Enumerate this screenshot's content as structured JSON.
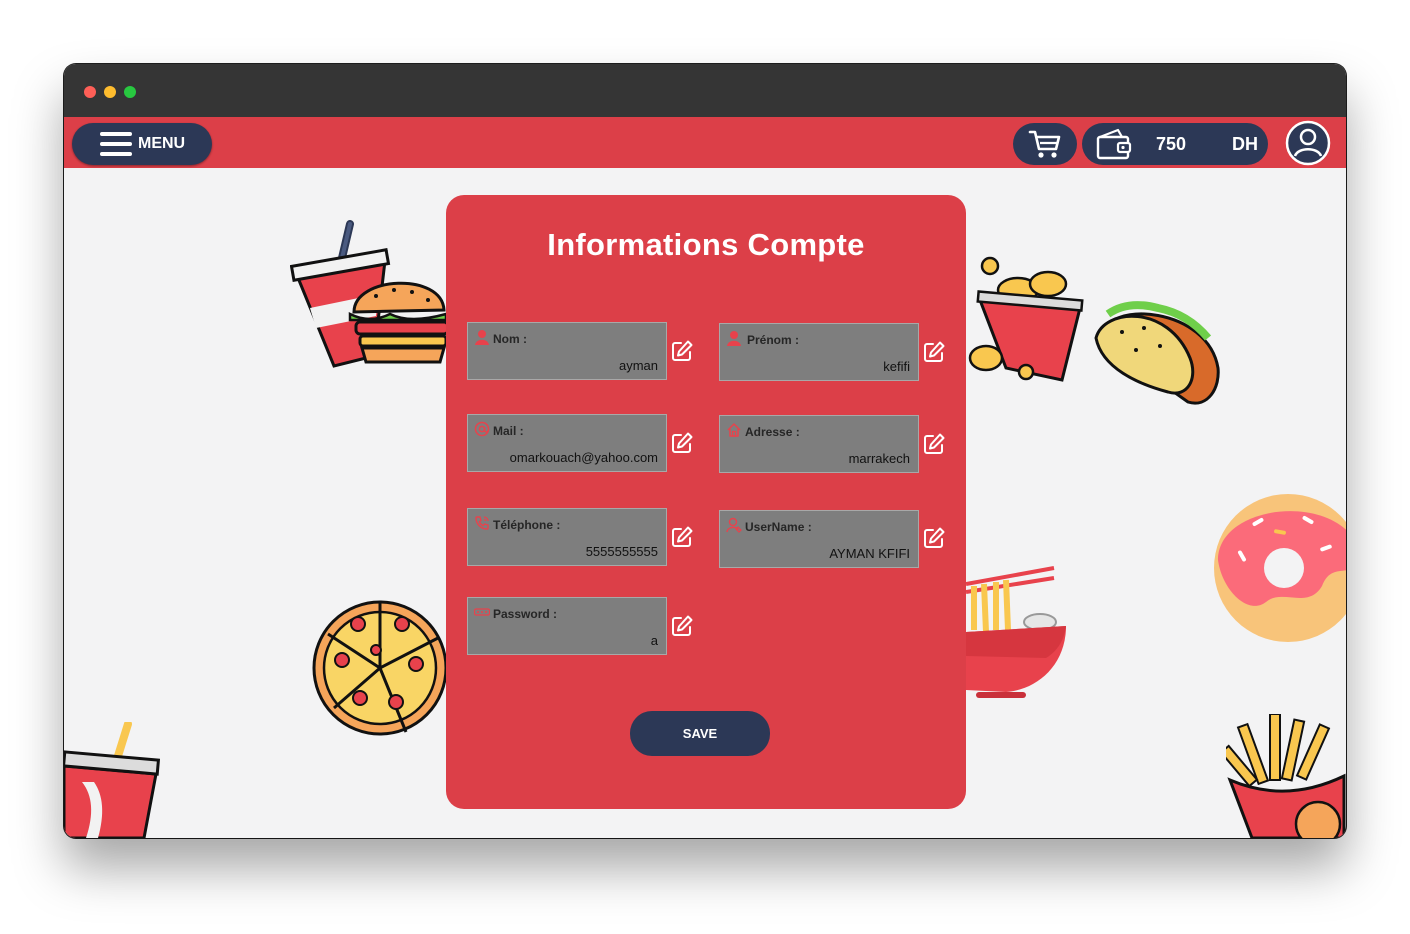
{
  "window": {
    "controls": [
      "close",
      "minimize",
      "maximize"
    ]
  },
  "navbar": {
    "menu_label": "MENU",
    "menu_icon": "hamburger-icon",
    "cart_icon": "cart-icon",
    "wallet": {
      "icon": "wallet-icon",
      "amount": "750",
      "currency": "DH"
    },
    "profile_icon": "user-circle-icon"
  },
  "form": {
    "title": "Informations Compte",
    "fields": [
      {
        "label": "Nom :",
        "value": "ayman",
        "icon": "user-icon"
      },
      {
        "label": "Prénom :",
        "value": "kefifi",
        "icon": "user-icon"
      },
      {
        "label": "Mail :",
        "value": "omarkouach@yahoo.com",
        "icon": "at-icon"
      },
      {
        "label": "Adresse :",
        "value": "marrakech",
        "icon": "home-icon"
      },
      {
        "label": "Téléphone :",
        "value": "5555555555",
        "icon": "phone-icon"
      },
      {
        "label": "UserName :",
        "value": "AYMAN KFIFI",
        "icon": "user-outline-icon"
      },
      {
        "label": "Password :",
        "value": "a",
        "icon": "password-icon"
      }
    ],
    "edit_icon": "edit-icon",
    "save_label": "SAVE"
  },
  "background_illustrations": [
    "soda-burger",
    "fried-chicken-bucket",
    "taco",
    "donut",
    "noodle-bowl",
    "pizza",
    "soda-cup",
    "french-fries"
  ],
  "colors": {
    "primary_red": "#dc3f48",
    "navy": "#2c3856",
    "field_gray": "#7e7e7e",
    "titlebar": "#353535",
    "page_bg": "#f3f3f4"
  }
}
